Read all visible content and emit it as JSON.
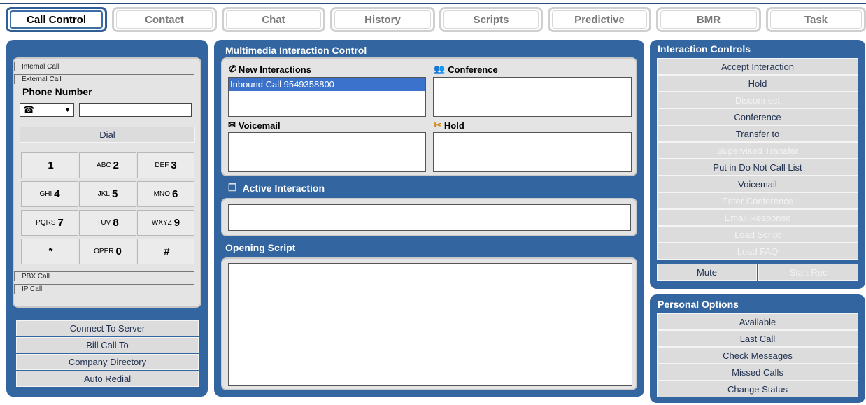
{
  "tabs": [
    {
      "label": "Call Control",
      "active": true
    },
    {
      "label": "Contact"
    },
    {
      "label": "Chat"
    },
    {
      "label": "History"
    },
    {
      "label": "Scripts"
    },
    {
      "label": "Predictive"
    },
    {
      "label": "BMR"
    },
    {
      "label": "Task"
    }
  ],
  "phone": {
    "tab_internal": "Internal Call",
    "tab_external": "External Call",
    "phone_number_label": "Phone Number",
    "phone_number_value": "",
    "dial_label": "Dial",
    "tab_pbx": "PBX Call",
    "tab_ip": "IP Call",
    "keys": [
      {
        "sub": "",
        "main": "1"
      },
      {
        "sub": "ABC",
        "main": "2"
      },
      {
        "sub": "DEF",
        "main": "3"
      },
      {
        "sub": "GHI",
        "main": "4"
      },
      {
        "sub": "JKL",
        "main": "5"
      },
      {
        "sub": "MNO",
        "main": "6"
      },
      {
        "sub": "PQRS",
        "main": "7"
      },
      {
        "sub": "TUV",
        "main": "8"
      },
      {
        "sub": "WXYZ",
        "main": "9"
      },
      {
        "sub": "",
        "main": "*"
      },
      {
        "sub": "OPER",
        "main": "0"
      },
      {
        "sub": "",
        "main": "#"
      }
    ]
  },
  "left_buttons": [
    "Connect To Server",
    "Bill Call To",
    "Company Directory",
    "Auto Redial"
  ],
  "multimedia": {
    "title": "Multimedia Interaction Control",
    "new_interactions": "New Interactions",
    "new_items": [
      "Inbound Call 9549358800"
    ],
    "conference": "Conference",
    "voicemail": "Voicemail",
    "hold": "Hold",
    "active_interaction": "Active Interaction",
    "opening_script": "Opening Script"
  },
  "interaction_controls": {
    "title": "Interaction Controls",
    "buttons": [
      {
        "label": "Accept Interaction",
        "enabled": true
      },
      {
        "label": "Hold",
        "enabled": true
      },
      {
        "label": "Disconnect",
        "enabled": false
      },
      {
        "label": "Conference",
        "enabled": true
      },
      {
        "label": "Transfer to",
        "enabled": true
      },
      {
        "label": "Supervised Transfer",
        "enabled": false
      },
      {
        "label": "Put in Do Not Call List",
        "enabled": true
      },
      {
        "label": "Voicemail",
        "enabled": true
      },
      {
        "label": "Enter Conference",
        "enabled": false
      },
      {
        "label": "Email Response",
        "enabled": false
      },
      {
        "label": "Load Script",
        "enabled": false
      },
      {
        "label": "Load FAQ",
        "enabled": false
      }
    ],
    "mute": "Mute",
    "start_rec": "Start Rec"
  },
  "personal_options": {
    "title": "Personal Options",
    "buttons": [
      "Available",
      "Last Call",
      "Check Messages",
      "Missed Calls",
      "Change Status"
    ]
  }
}
